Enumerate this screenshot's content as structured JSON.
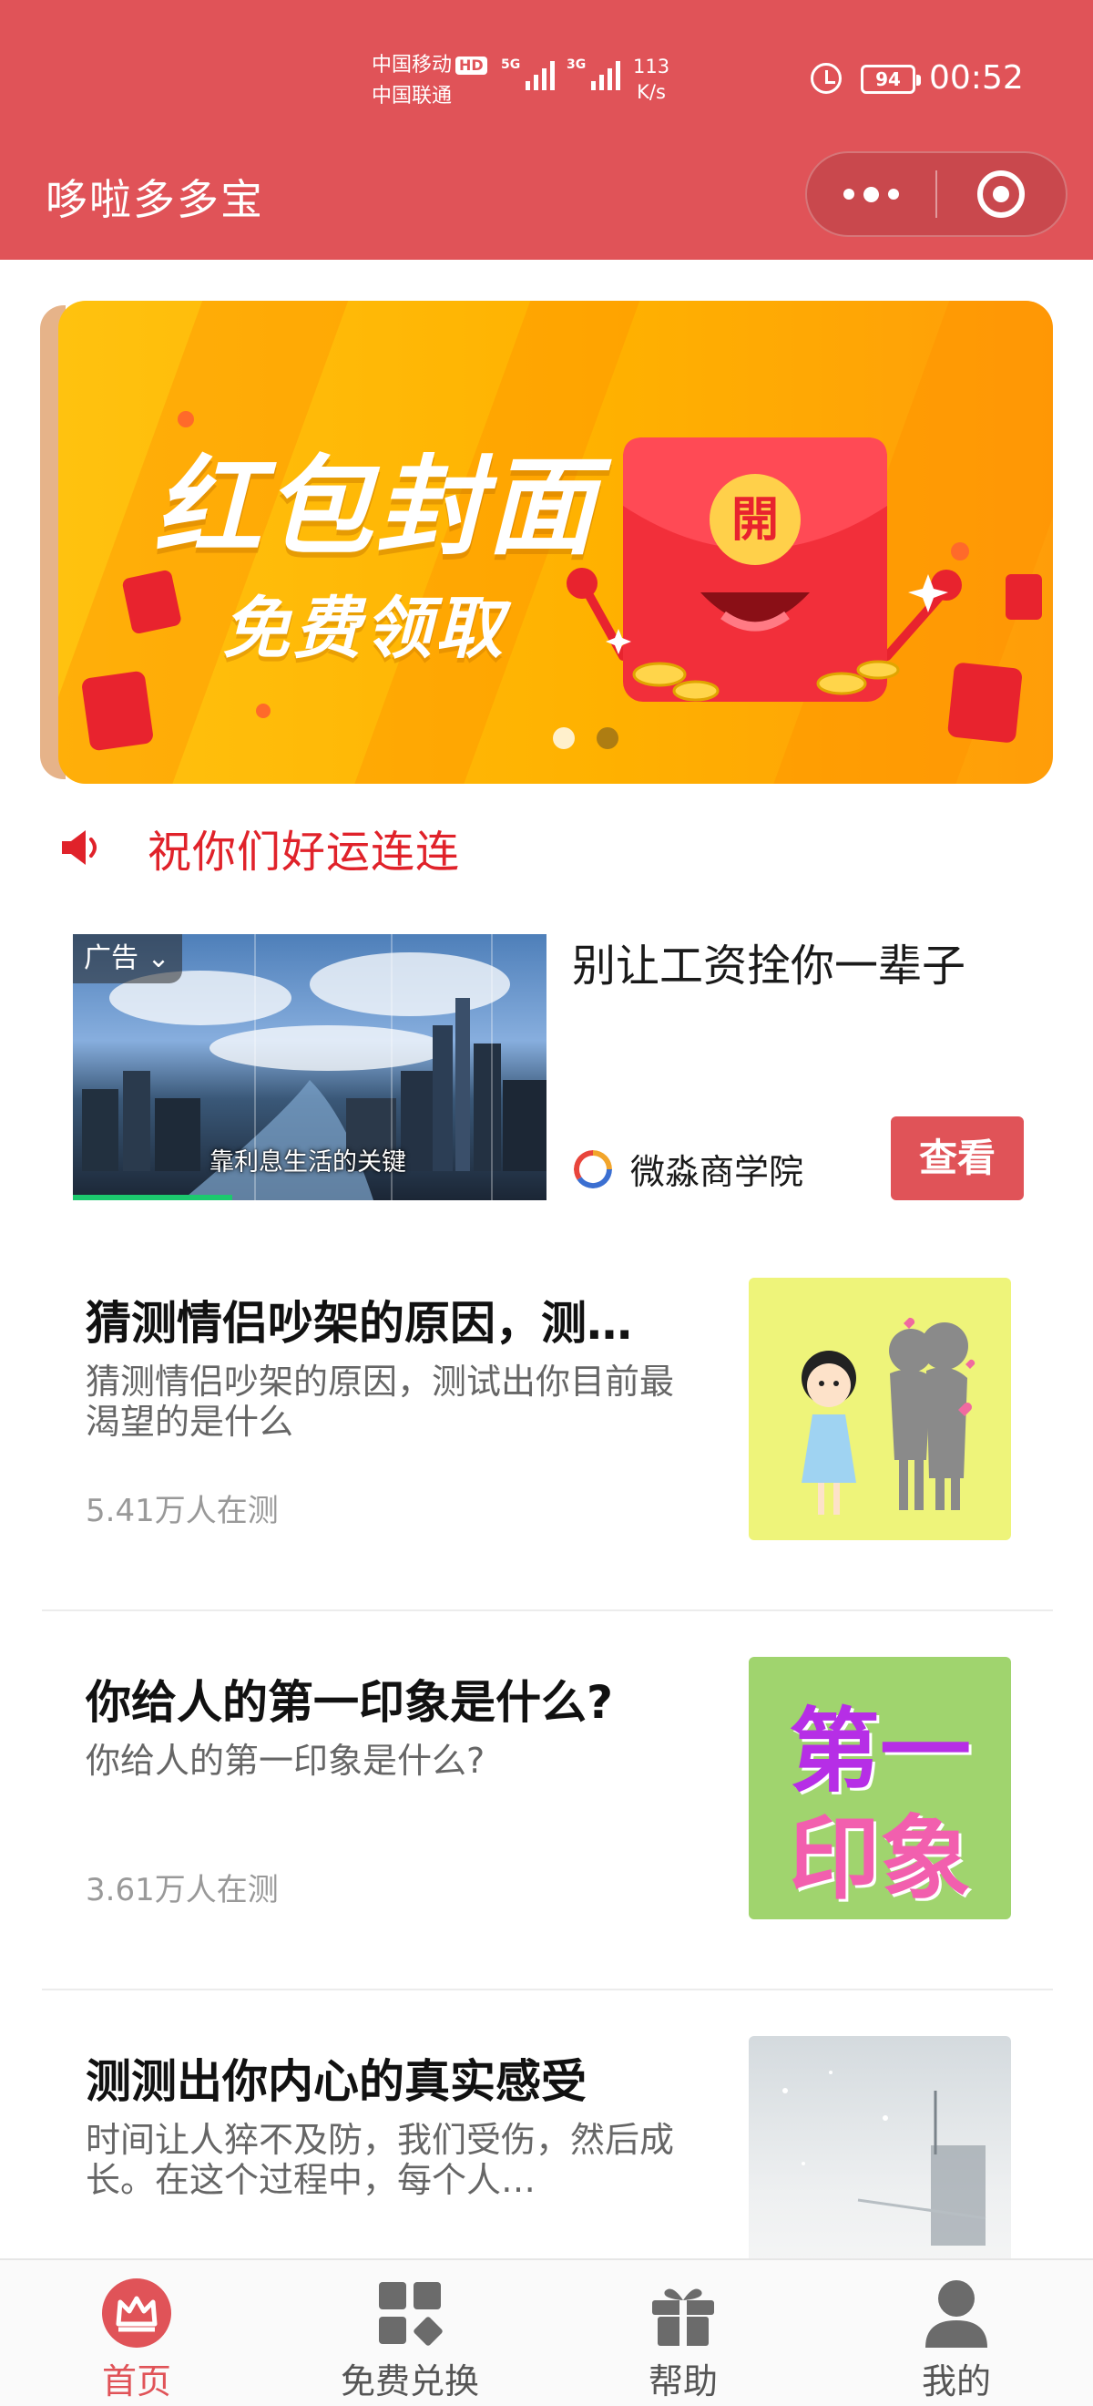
{
  "status_bar": {
    "carrier_1": "中国移动",
    "carrier_1_badge": "HD",
    "carrier_2": "中国联通",
    "sim1_label": "5G",
    "sim2_label": "3G",
    "net_speed_value": "113",
    "net_speed_unit": "K/s",
    "battery": "94",
    "time": "00:52"
  },
  "header": {
    "title": "哆啦多多宝",
    "capsule_more_icon": "more-dots-icon",
    "capsule_close_icon": "record-close-icon",
    "color": "#e05358"
  },
  "banner": {
    "title": "红包封面",
    "subtitle": "免费领取",
    "envelope_char": "開",
    "slide_count": 2,
    "active_slide": 1
  },
  "notice": {
    "icon": "speaker-icon",
    "text": "祝你们好运连连",
    "color": "#e0222a"
  },
  "ad": {
    "tag": "广告",
    "video_caption": "靠利息生活的关键",
    "headline": "别让工资拴你一辈子",
    "source": "微淼商学院",
    "button": "查看"
  },
  "quizzes": [
    {
      "title": "猜测情侣吵架的原因，测试出你目前最渴望的是什么",
      "desc": "猜测情侣吵架的原因，测试出你目前最渴望的是什么",
      "count": "5.41万人在测",
      "thumb_bg": "#eef47a"
    },
    {
      "title": "你给人的第一印象是什么?",
      "desc": "你给人的第一印象是什么?",
      "count": "3.61万人在测",
      "thumb_bg": "#a0d46e",
      "thumb_line1": "第一",
      "thumb_line2": "印象"
    },
    {
      "title": "测测出你内心的真实感受",
      "desc": "时间让人猝不及防，我们受伤，然后成长。在这个过程中，每个人…",
      "count": "",
      "thumb_bg": "#dfe3e6"
    }
  ],
  "tabbar": {
    "items": [
      {
        "label": "首页",
        "icon": "crown-home-icon",
        "active": true
      },
      {
        "label": "免费兑换",
        "icon": "grid-exchange-icon",
        "active": false
      },
      {
        "label": "帮助",
        "icon": "gift-help-icon",
        "active": false
      },
      {
        "label": "我的",
        "icon": "user-profile-icon",
        "active": false
      }
    ],
    "active_color": "#e05358"
  }
}
